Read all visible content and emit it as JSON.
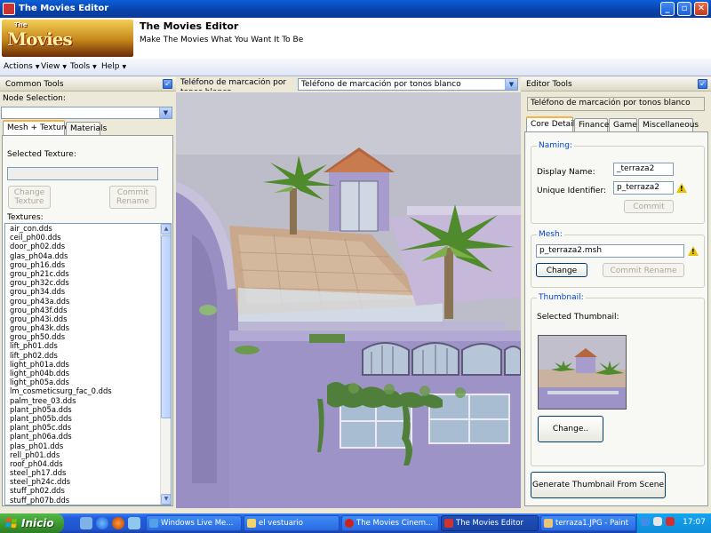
{
  "window": {
    "title": "The Movies Editor"
  },
  "header": {
    "logo_text": "Movies",
    "logo_small": "The",
    "title": "The Movies Editor",
    "subtitle": "Make The Movies What You Want It To Be"
  },
  "menu": [
    {
      "label": "Actions"
    },
    {
      "label": "View"
    },
    {
      "label": "Tools"
    },
    {
      "label": "Help"
    }
  ],
  "left": {
    "header": "Common Tools",
    "node_label": "Node Selection:",
    "node_value": "",
    "tabs": [
      "Mesh + Textures",
      "Materials"
    ],
    "selected_texture_label": "Selected Texture:",
    "selected_texture_value": "",
    "change_texture": "Change Texture",
    "commit_rename": "Commit Rename",
    "textures_label": "Textures:",
    "textures": [
      "air_con.dds",
      "ceil_ph00.dds",
      "door_ph02.dds",
      "glas_ph04a.dds",
      "grou_ph16.dds",
      "grou_ph21c.dds",
      "grou_ph32c.dds",
      "grou_ph34.dds",
      "grou_ph43a.dds",
      "grou_ph43f.dds",
      "grou_ph43i.dds",
      "grou_ph43k.dds",
      "grou_ph50.dds",
      "lift_ph01.dds",
      "lift_ph02.dds",
      "light_ph01a.dds",
      "light_ph04b.dds",
      "light_ph05a.dds",
      "lm_cosmeticsurg_fac_0.dds",
      "palm_tree_03.dds",
      "plant_ph05a.dds",
      "plant_ph05b.dds",
      "plant_ph05c.dds",
      "plant_ph06a.dds",
      "plas_ph01.dds",
      "rell_ph01.dds",
      "roof_ph04.dds",
      "steel_ph17.dds",
      "steel_ph24c.dds",
      "stuff_ph02.dds",
      "stuff_ph07b.dds"
    ]
  },
  "center": {
    "object_label": "Teléfono de marcación por tonos blanco",
    "object_select": "Teléfono de marcación por tonos blanco"
  },
  "right": {
    "header": "Editor Tools",
    "object_name": "Teléfono de marcación por tonos blanco",
    "tabs": [
      "Core Details",
      "Finance",
      "Game",
      "Miscellaneous"
    ],
    "naming_label": "Naming:",
    "display_name_label": "Display Name:",
    "display_name_value": "_terraza2",
    "unique_id_label": "Unique Identifier:",
    "unique_id_value": "p_terraza2",
    "commit": "Commit",
    "mesh_label": "Mesh:",
    "mesh_value": "p_terraza2.msh",
    "change": "Change",
    "commit_rename": "Commit Rename",
    "thumbnail_label": "Thumbnail:",
    "selected_thumbnail": "Selected Thumbnail:",
    "change_thumb": "Change..",
    "generate": "Generate Thumbnail  From Scene"
  },
  "taskbar": {
    "start": "Inicio",
    "tasks": [
      {
        "label": "Windows Live Me..."
      },
      {
        "label": "el vestuario"
      },
      {
        "label": "The Movies Cinem..."
      },
      {
        "label": "The Movies Editor"
      },
      {
        "label": "terraza1.JPG - Paint"
      }
    ],
    "clock": "17:07"
  },
  "colors": {
    "titlebar": "#0a5fd8",
    "taskbar": "#245edb",
    "start": "#3a962e",
    "accent_tab": "#f7b343",
    "wall": "#9e93c6"
  }
}
